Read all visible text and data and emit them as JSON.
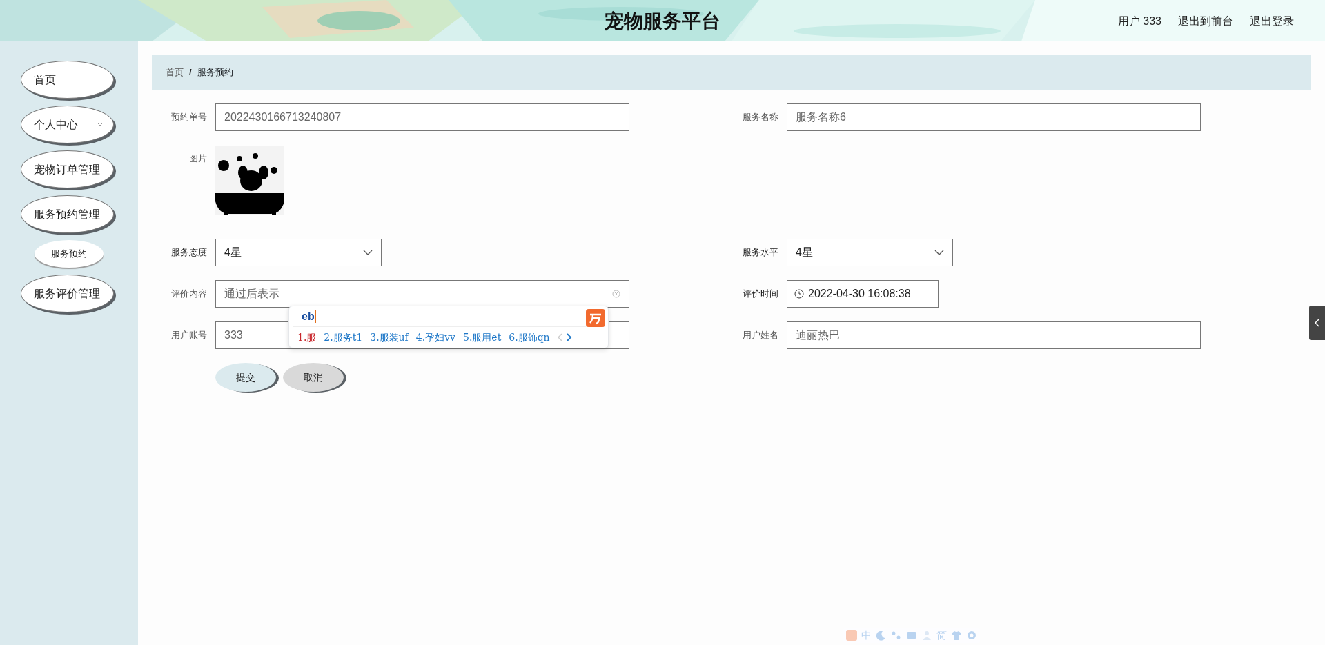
{
  "header": {
    "title": "宠物服务平台",
    "user": "用户 333",
    "links": [
      "退出到前台",
      "退出登录"
    ]
  },
  "sidebar": {
    "items": [
      {
        "label": "首页",
        "selected": false
      },
      {
        "label": "个人中心",
        "selected": false,
        "expanded": false
      },
      {
        "label": "宠物订单管理",
        "selected": false
      },
      {
        "label": "服务预约管理",
        "selected": false,
        "children": [
          {
            "label": "服务预约",
            "selected": true
          }
        ]
      },
      {
        "label": "服务评价管理",
        "selected": false
      }
    ]
  },
  "breadcrumb": {
    "items": [
      "首页",
      "服务预约"
    ],
    "separator": "/"
  },
  "form": {
    "rows": [
      [
        {
          "label": "预约单号",
          "kind": "text",
          "value": "2022430166713240807"
        },
        {
          "label": "服务名称",
          "kind": "text",
          "value": "服务名称6"
        }
      ],
      [
        {
          "label": "图片"
        }
      ],
      [
        {
          "label": "服务态度",
          "kind": "select",
          "value": "4星"
        },
        {
          "label": "服务水平",
          "kind": "select",
          "value": "4星"
        }
      ],
      [
        {
          "label": "评价内容",
          "kind": "clearable",
          "value": "通过后表示"
        },
        {
          "label": "评价时间",
          "kind": "datetime",
          "value": "2022-04-30 16:08:38"
        }
      ],
      [
        {
          "label": "用户账号",
          "kind": "text",
          "value": "333"
        },
        {
          "label": "用户姓名",
          "kind": "text",
          "value": "迪丽热巴"
        }
      ]
    ],
    "buttons": [
      {
        "label": "提交",
        "kind": "primary"
      },
      {
        "label": "取消",
        "kind": "secondary"
      }
    ]
  },
  "ime_popup": {
    "input": "eb",
    "candidates": [
      {
        "text": "1.服",
        "selected": true
      },
      {
        "text": "2.服务t1",
        "selected": false
      },
      {
        "text": "3.服装uf",
        "selected": false
      },
      {
        "text": "4.孕妇vv",
        "selected": false
      },
      {
        "text": "5.服用et",
        "selected": false
      },
      {
        "text": "6.服饰qn",
        "selected": false
      }
    ]
  },
  "ime_toolbar": {
    "mode": "中",
    "script": "简"
  }
}
